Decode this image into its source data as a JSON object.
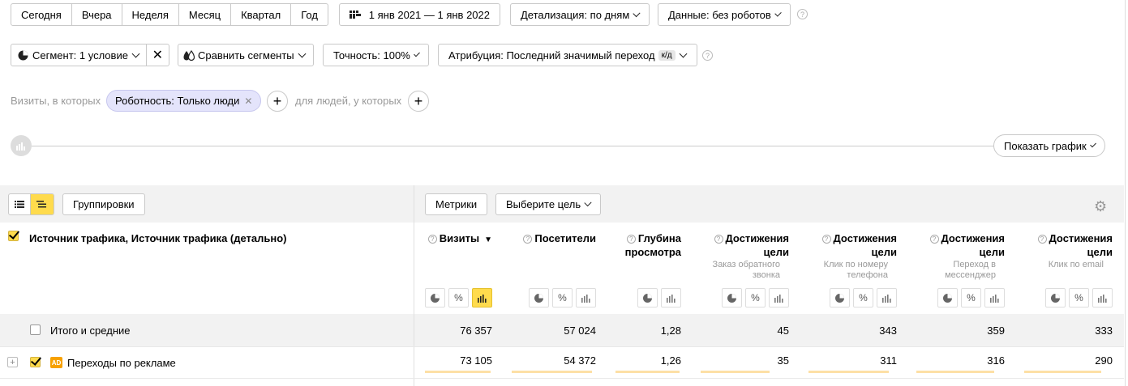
{
  "period": {
    "today": "Сегодня",
    "yesterday": "Вчера",
    "week": "Неделя",
    "month": "Месяц",
    "quarter": "Квартал",
    "year": "Год"
  },
  "date_range": "1 янв 2021 — 1 янв 2022",
  "detail": "Детализация: по дням",
  "data_filter": "Данные: без роботов",
  "segment": "Сегмент: 1 условие",
  "compare": "Сравнить сегменты",
  "accuracy": "Точность: 100%",
  "attribution": "Атрибуция: Последний значимый переход",
  "attribution_badge": "к/д",
  "visits_prefix": "Визиты, в которых",
  "filter_chip": "Роботность: Только люди",
  "people_prefix": "для людей, у которых",
  "show_chart": "Показать график",
  "groupings": "Группировки",
  "metrics": "Метрики",
  "choose_goal": "Выберите цель",
  "dim_header": "Источник трафика, Источник трафика (детально)",
  "columns": [
    {
      "title": "Визиты",
      "sub": "",
      "sort": "▼"
    },
    {
      "title": "Посетители",
      "sub": ""
    },
    {
      "title": "Глубина просмотра",
      "sub": ""
    },
    {
      "title": "Достижения цели",
      "sub": "Заказ обратного звонка"
    },
    {
      "title": "Достижения цели",
      "sub": "Клик по номеру телефона"
    },
    {
      "title": "Достижения цели",
      "sub": "Переход в мессенджер"
    },
    {
      "title": "Достижения цели",
      "sub": "Клик по email"
    }
  ],
  "totals": {
    "label": "Итого и средние",
    "values": [
      "76 357",
      "57 024",
      "1,28",
      "45",
      "343",
      "359",
      "333"
    ]
  },
  "rows": [
    {
      "badge": "AD",
      "label": "Переходы по рекламе",
      "values": [
        "73 105",
        "54 372",
        "1,26",
        "35",
        "311",
        "316",
        "290"
      ],
      "shares": [
        0.96,
        0.95,
        0.98,
        0.78,
        0.91,
        0.88,
        0.87
      ]
    }
  ],
  "icons": {
    "calendar": "calendar-icon",
    "settings": "gear-icon"
  }
}
